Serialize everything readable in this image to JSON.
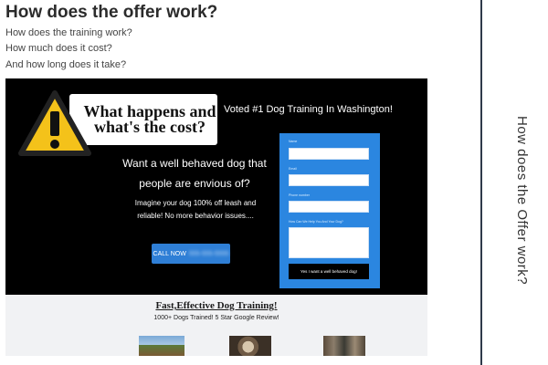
{
  "header": {
    "title": "How does the offer work?",
    "lines": [
      "How does the training work?",
      "How much does it cost?",
      "And how long does it take?"
    ]
  },
  "side_label": "How does the Offer work?",
  "landing": {
    "cost_box": [
      "What happens and",
      "what's the cost?"
    ],
    "voted": "Voted #1 Dog Training In Washington!",
    "want": "Want a well behaved dog that people are envious of?",
    "imagine": "Imagine your dog 100% off leash and reliable! No more behavior issues....",
    "call_label": "CALL NOW",
    "call_number": "555-555-5555",
    "form": {
      "name": "Name",
      "email": "Email",
      "phone": "Phone number",
      "help": "How Can We Help You And Your Dog?",
      "submit": "Yes I want a well behaved dog!"
    },
    "fast": "Fast,Effective Dog Training!",
    "trained": "1000+ Dogs Trained! 5 Star Google Review!"
  },
  "colors": {
    "form_blue": "#2b86e0",
    "button_blue": "#2f7fd6",
    "warning_yellow": "#f4c21a"
  },
  "icons": [
    "warning-icon"
  ]
}
